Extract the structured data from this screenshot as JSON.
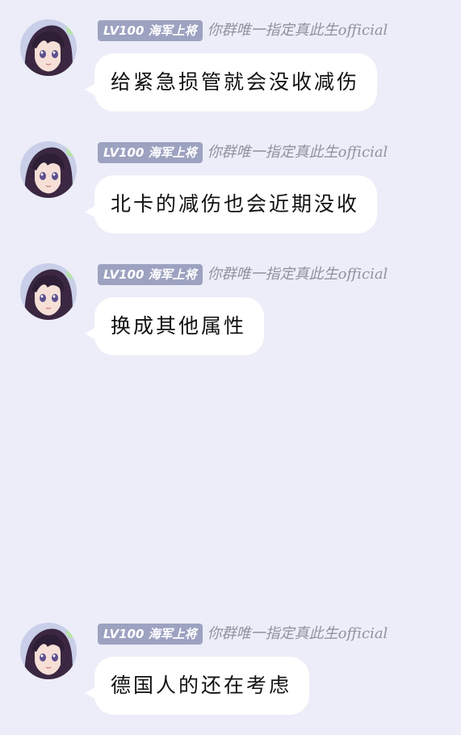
{
  "messages": [
    {
      "badge": "LV100 海军上将",
      "sender": "你群唯一指定真此生official",
      "text": "给紧急损管就会没收减伤"
    },
    {
      "badge": "LV100 海军上将",
      "sender": "你群唯一指定真此生official",
      "text": "北卡的减伤也会近期没收"
    },
    {
      "badge": "LV100 海军上将",
      "sender": "你群唯一指定真此生official",
      "text": "换成其他属性"
    },
    {
      "badge": "LV100 海军上将",
      "sender": "你群唯一指定真此生official",
      "text": "德国人的还在考虑"
    }
  ]
}
